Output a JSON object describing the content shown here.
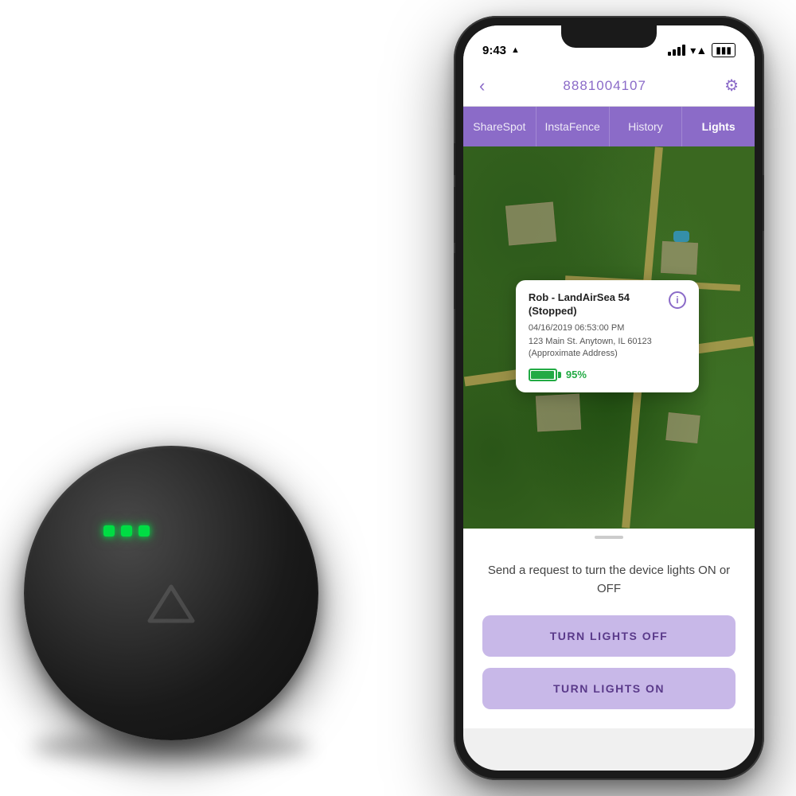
{
  "status_bar": {
    "time": "9:43",
    "location_arrow": "▲"
  },
  "nav": {
    "back_label": "‹",
    "title": "8881004107",
    "gear_label": "⚙"
  },
  "tabs": [
    {
      "id": "sharespot",
      "label": "ShareSpot",
      "active": false
    },
    {
      "id": "instafence",
      "label": "InstaFence",
      "active": false
    },
    {
      "id": "history",
      "label": "History",
      "active": false
    },
    {
      "id": "lights",
      "label": "Lights",
      "active": true
    }
  ],
  "map_popup": {
    "device_name": "Rob - LandAirSea 54",
    "status": "(Stopped)",
    "datetime": "04/16/2019 06:53:00 PM",
    "address_line1": "123 Main St. Anytown, IL 60123",
    "address_line2": "(Approximate Address)",
    "battery_pct": "95%",
    "info_icon": "i"
  },
  "bottom_panel": {
    "description": "Send a request to turn the device lights\nON or OFF",
    "btn_off_label": "TURN LIGHTS OFF",
    "btn_on_label": "TURN LIGHTS ON"
  },
  "colors": {
    "accent": "#8b6bc8",
    "button_bg": "#c8b8e8",
    "button_text": "#5a3a8a",
    "battery_green": "#22aa44"
  }
}
